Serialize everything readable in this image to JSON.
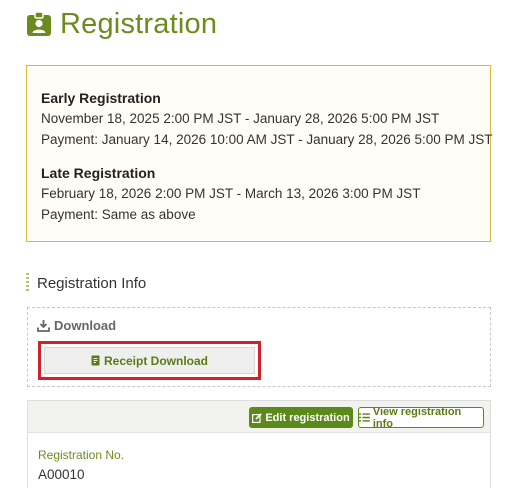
{
  "page": {
    "title": "Registration",
    "title_icon": "id-badge-icon",
    "accent": "#6b8c1d"
  },
  "periods": [
    {
      "title": "Early Registration",
      "dates": "November 18, 2025 2:00 PM JST - January 28, 2026 5:00 PM JST",
      "payment": "Payment: January 14, 2026 10:00 AM JST - January 28, 2026 5:00 PM JST"
    },
    {
      "title": "Late Registration",
      "dates": "February 18, 2026 2:00 PM JST - March 13, 2026 3:00 PM JST",
      "payment": "Payment: Same as above"
    }
  ],
  "section": {
    "heading": "Registration Info"
  },
  "download": {
    "label": "Download",
    "icon": "download-icon",
    "receipt_button": "Receipt Download",
    "receipt_icon": "document-icon",
    "highlight_color": "#d4202a"
  },
  "registration": {
    "edit_button": "Edit registration",
    "edit_icon": "edit-icon",
    "view_button": "View registration info",
    "view_icon": "list-icon",
    "number_label": "Registration No.",
    "number_value": "A00010"
  }
}
